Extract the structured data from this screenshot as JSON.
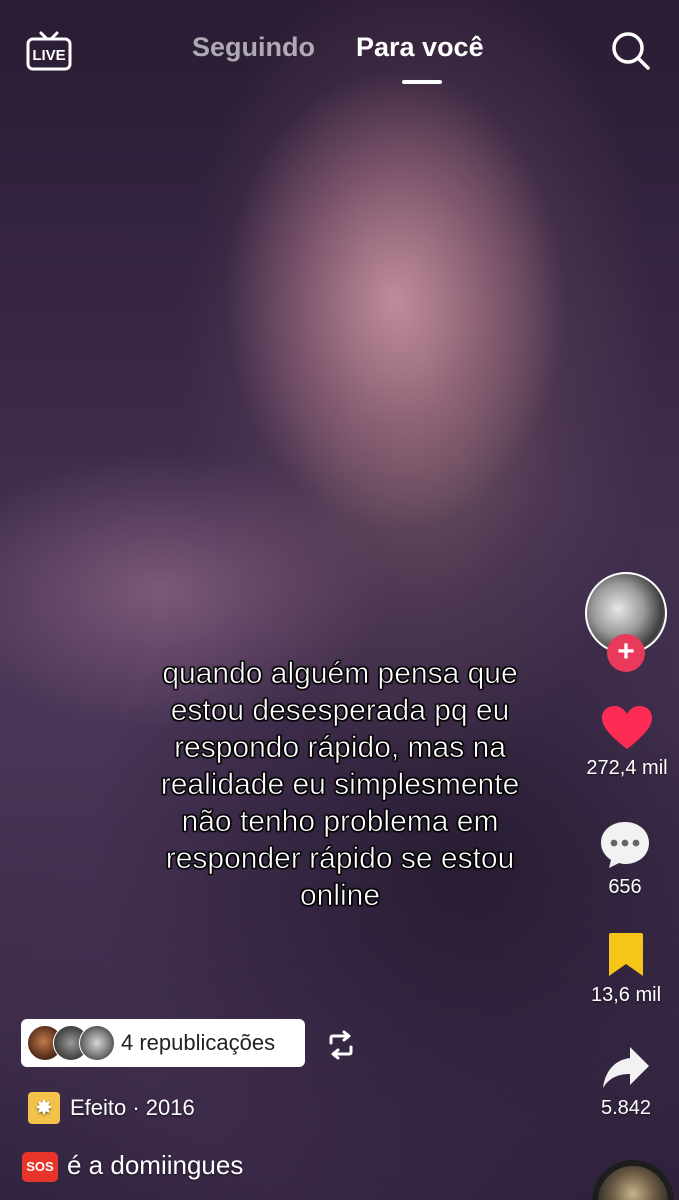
{
  "header": {
    "live_icon": "live-tv-icon",
    "live_label": "LIVE",
    "tabs": [
      {
        "label": "Seguindo",
        "active": false
      },
      {
        "label": "Para você",
        "active": true
      }
    ],
    "search_icon": "search-icon"
  },
  "video": {
    "caption": "quando alguém pensa que\nestou desesperada pq eu\nrespondo rápido, mas na\nrealidade eu simplesmente\nnão tenho problema em\nresponder rápido se estou\nonline"
  },
  "rail": {
    "follow_symbol": "+",
    "likes": "272,4 mil",
    "comments": "656",
    "saves": "13,6 mil",
    "shares": "5.842",
    "like_color": "#fe2c55",
    "save_color": "#f5c518"
  },
  "bottom": {
    "reposts_label": "4 republicações",
    "effect_label": "Efeito · 2016",
    "effect_icon": "sparkle-effect-icon",
    "sos_badge": "SOS",
    "username": "é a domiingues"
  }
}
